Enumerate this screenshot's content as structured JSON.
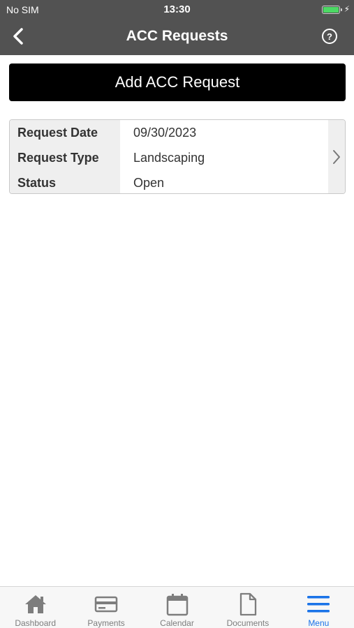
{
  "status_bar": {
    "carrier": "No SIM",
    "time": "13:30",
    "battery_level": 1.0
  },
  "nav": {
    "title": "ACC Requests",
    "back_icon": "chevron-left-icon",
    "help_icon": "question-circle-icon"
  },
  "actions": {
    "add_label": "Add ACC Request"
  },
  "requests": [
    {
      "rows": [
        {
          "label": "Request Date",
          "value": "09/30/2023"
        },
        {
          "label": "Request Type",
          "value": "Landscaping"
        },
        {
          "label": "Status",
          "value": "Open"
        }
      ]
    }
  ],
  "tabbar": {
    "items": [
      {
        "label": "Dashboard",
        "icon": "home-icon",
        "active": false
      },
      {
        "label": "Payments",
        "icon": "credit-card-icon",
        "active": false
      },
      {
        "label": "Calendar",
        "icon": "calendar-icon",
        "active": false
      },
      {
        "label": "Documents",
        "icon": "document-icon",
        "active": false
      },
      {
        "label": "Menu",
        "icon": "menu-icon",
        "active": true
      }
    ]
  },
  "colors": {
    "header": "#525252",
    "button": "#000000",
    "accent": "#1a73e8",
    "inactive": "#7d7d7d"
  }
}
